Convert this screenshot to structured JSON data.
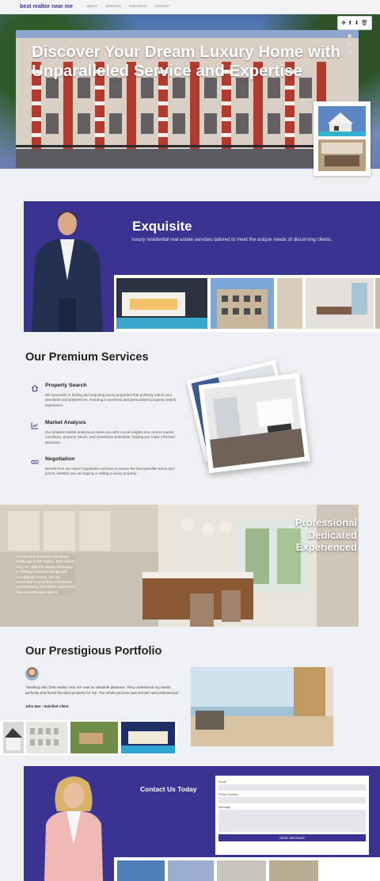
{
  "nav": {
    "brand": "best realtor near me",
    "links": [
      "ABOUT",
      "SERVICES",
      "PORTFOLIO",
      "CONTACT"
    ]
  },
  "hero": {
    "title": "Discover Your Dream Luxury Home with Unparalleled Service and Expertise",
    "toolbar_icons": [
      "move-icon",
      "upload-icon",
      "download-icon",
      "trash-icon"
    ]
  },
  "intro": {
    "title": "Exquisite",
    "description": "luxury residential real estate services tailored to meet the unique needs of discerning clients."
  },
  "services": {
    "heading": "Our Premium Services",
    "items": [
      {
        "icon": "home-icon",
        "title": "Property Search",
        "description": "We specialize in finding and acquiring luxury properties that perfectly match your standards and preferences, ensuring a seamless and personalized property search experience."
      },
      {
        "icon": "chart-icon",
        "title": "Market Analysis",
        "description": "Our detailed market analysis provides you with crucial insights into current market conditions, property values, and investment potentials, helping you make informed decisions."
      },
      {
        "icon": "handshake-icon",
        "title": "Negotiation",
        "description": "Benefit from our expert negotiation services to secure the best possible terms and prices, whether you are buying or selling a luxury property."
      }
    ]
  },
  "feature": {
    "overlay_text": "As a leading boutique real estate brokerage in the region, 'best realtor near me' delivers unique advantage in offering exclusive listings and exceptional service. We are committed to providing a seamless and satisfying real estate experience that exceeds expectations.",
    "tagline_lines": [
      "Professional",
      "Dedicated",
      "Experienced"
    ]
  },
  "portfolio": {
    "heading": "Our Prestigious Portfolio",
    "quote": "\"Working with 'best realtor near me' was an absolute pleasure. They understood my needs perfectly and found the ideal property for me. The whole process was smooth and professional.\"",
    "client": "John Doe - Satisfied Client"
  },
  "contact": {
    "heading": "Contact Us Today",
    "email_label": "Email",
    "phone_label": "Phone Number",
    "message_label": "Message",
    "submit_label": "SEND MESSAGE"
  },
  "colors": {
    "brand": "#3a3391",
    "background": "#eff0f3"
  }
}
